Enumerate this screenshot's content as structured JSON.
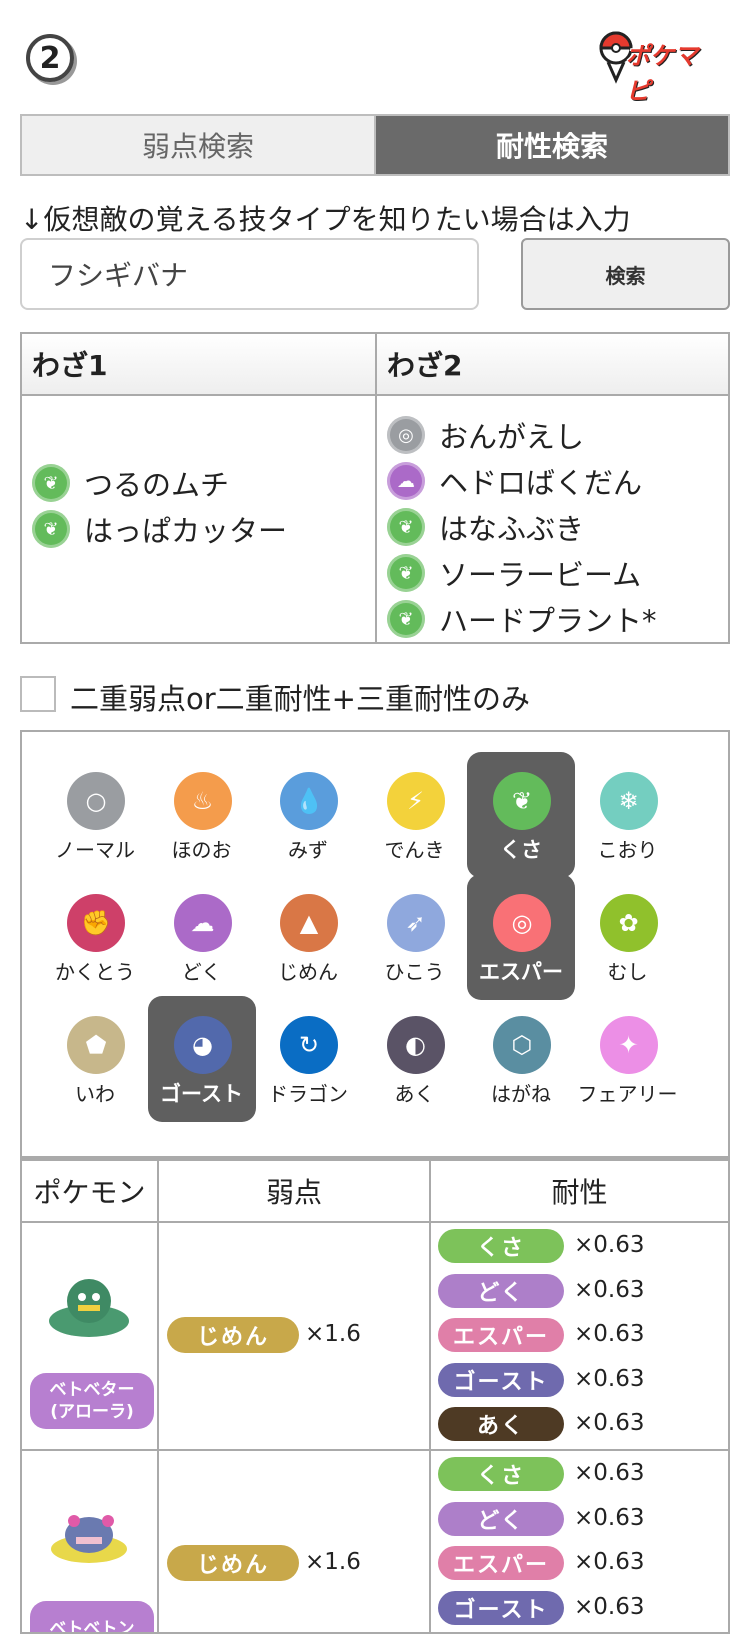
{
  "header": {
    "step": "2",
    "logo_text": "ポケマピ"
  },
  "tabs": [
    {
      "label": "弱点検索",
      "active": false
    },
    {
      "label": "耐性検索",
      "active": true
    }
  ],
  "hint": "↓仮想敵の覚える技タイプを知りたい場合は入力",
  "search": {
    "value": "フシギバナ",
    "button": "検索"
  },
  "moves": {
    "col1_header": "わざ1",
    "col2_header": "わざ2",
    "col1": [
      {
        "name": "つるのムチ",
        "type": "grass"
      },
      {
        "name": "はっぱカッター",
        "type": "grass"
      }
    ],
    "col2": [
      {
        "name": "おんがえし",
        "type": "normal"
      },
      {
        "name": "ヘドロばくだん",
        "type": "poison"
      },
      {
        "name": "はなふぶき",
        "type": "grass"
      },
      {
        "name": "ソーラービーム",
        "type": "grass"
      },
      {
        "name": "ハードプラント*",
        "type": "grass"
      }
    ]
  },
  "filter": {
    "label": "二重弱点or二重耐性+三重耐性のみ",
    "checked": false
  },
  "types": [
    {
      "label": "ノーマル",
      "icon": "normal-icon",
      "color": "#9a9da1",
      "selected": false
    },
    {
      "label": "ほのお",
      "icon": "fire-icon",
      "color": "#f49c4c",
      "selected": false
    },
    {
      "label": "みず",
      "icon": "water-icon",
      "color": "#5a9ddc",
      "selected": false
    },
    {
      "label": "でんき",
      "icon": "electric-icon",
      "color": "#f3d23b",
      "selected": false
    },
    {
      "label": "くさ",
      "icon": "grass-icon",
      "color": "#63bb5b",
      "selected": true
    },
    {
      "label": "こおり",
      "icon": "ice-icon",
      "color": "#74cec0",
      "selected": false
    },
    {
      "label": "かくとう",
      "icon": "fighting-icon",
      "color": "#ce4069",
      "selected": false
    },
    {
      "label": "どく",
      "icon": "poison-icon",
      "color": "#ab6ac8",
      "selected": false
    },
    {
      "label": "じめん",
      "icon": "ground-icon",
      "color": "#d97746",
      "selected": false
    },
    {
      "label": "ひこう",
      "icon": "flying-icon",
      "color": "#8fa8dd",
      "selected": false
    },
    {
      "label": "エスパー",
      "icon": "psychic-icon",
      "color": "#f97176",
      "selected": true
    },
    {
      "label": "むし",
      "icon": "bug-icon",
      "color": "#90c12c",
      "selected": false
    },
    {
      "label": "いわ",
      "icon": "rock-icon",
      "color": "#c7b78b",
      "selected": false
    },
    {
      "label": "ゴースト",
      "icon": "ghost-icon",
      "color": "#5269ac",
      "selected": true
    },
    {
      "label": "ドラゴン",
      "icon": "dragon-icon",
      "color": "#0a6dc4",
      "selected": false
    },
    {
      "label": "あく",
      "icon": "dark-icon",
      "color": "#5a5366",
      "selected": false
    },
    {
      "label": "はがね",
      "icon": "steel-icon",
      "color": "#5a8ea1",
      "selected": false
    },
    {
      "label": "フェアリー",
      "icon": "fairy-icon",
      "color": "#ec8fe6",
      "selected": false
    }
  ],
  "results": {
    "headers": [
      "ポケモン",
      "弱点",
      "耐性"
    ],
    "rows": [
      {
        "name_line1": "ベトベター",
        "name_line2": "(アローラ)",
        "weak": [
          {
            "type": "じめん",
            "color": "#c8a84a",
            "mult": "×1.6"
          }
        ],
        "resist": [
          {
            "type": "くさ",
            "color": "#7dc25a",
            "mult": "×0.63"
          },
          {
            "type": "どく",
            "color": "#ad7fc9",
            "mult": "×0.63"
          },
          {
            "type": "エスパー",
            "color": "#e07fa8",
            "mult": "×0.63"
          },
          {
            "type": "ゴースト",
            "color": "#6f6aae",
            "mult": "×0.63"
          },
          {
            "type": "あく",
            "color": "#4e3a24",
            "mult": "×0.63"
          }
        ]
      },
      {
        "name_line1": "ベトベトン",
        "name_line2": "",
        "weak": [
          {
            "type": "じめん",
            "color": "#c8a84a",
            "mult": "×1.6"
          }
        ],
        "resist": [
          {
            "type": "くさ",
            "color": "#7dc25a",
            "mult": "×0.63"
          },
          {
            "type": "どく",
            "color": "#ad7fc9",
            "mult": "×0.63"
          },
          {
            "type": "エスパー",
            "color": "#e07fa8",
            "mult": "×0.63"
          },
          {
            "type": "ゴースト",
            "color": "#6f6aae",
            "mult": "×0.63"
          }
        ]
      }
    ]
  },
  "colors": {
    "grass": "#63bb5b",
    "normal": "#9a9da1",
    "poison": "#ab6ac8",
    "tab_active": "#6a6a6a"
  }
}
